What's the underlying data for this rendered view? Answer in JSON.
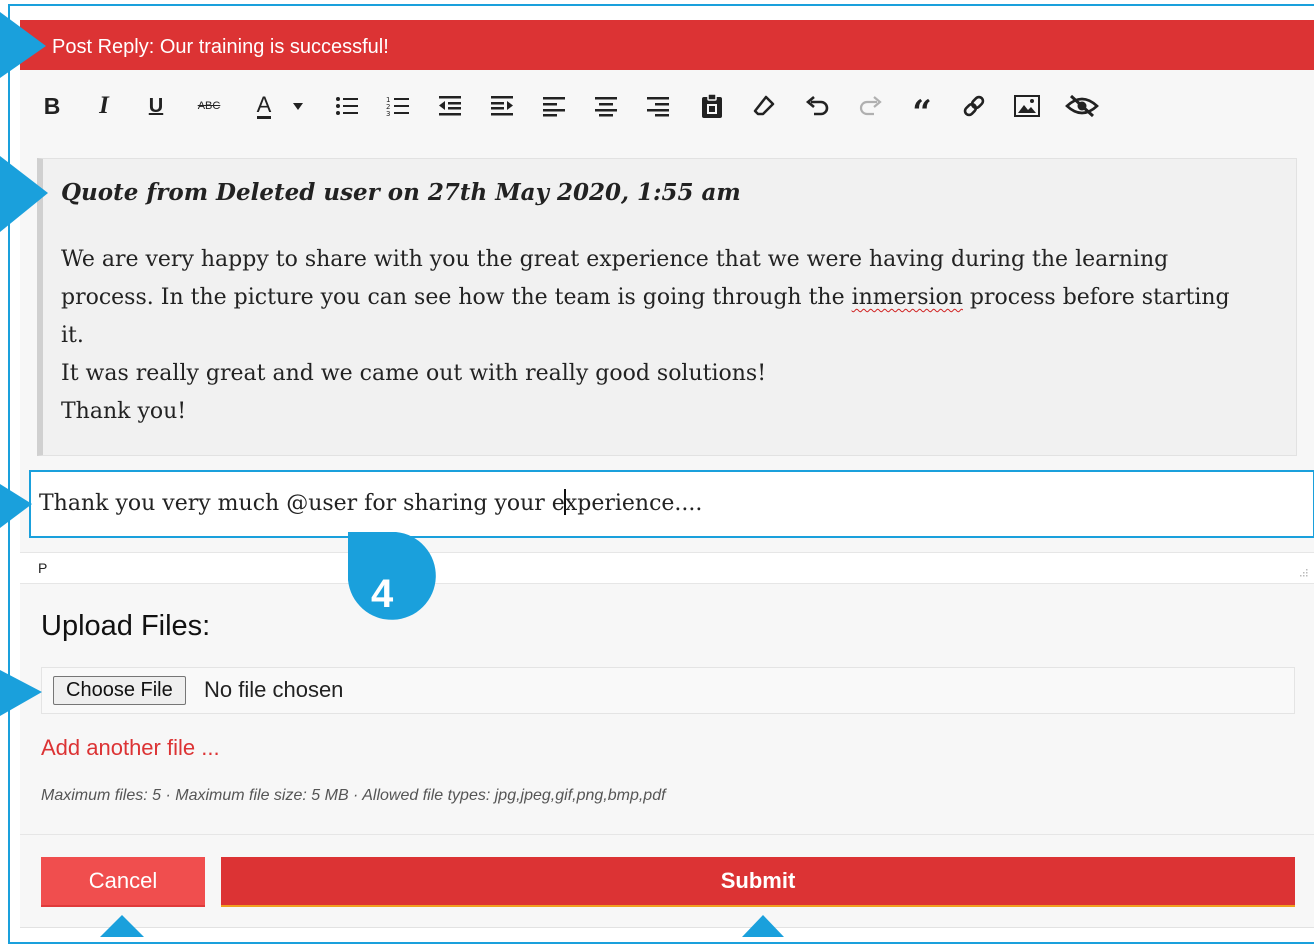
{
  "title": "Post Reply: Our training is successful!",
  "toolbar": {
    "items": [
      {
        "name": "bold-icon"
      },
      {
        "name": "italic-icon"
      },
      {
        "name": "underline-icon"
      },
      {
        "name": "strikethrough-icon"
      },
      {
        "name": "text-color-icon"
      },
      {
        "name": "color-dropdown-icon"
      },
      {
        "name": "bullet-list-icon"
      },
      {
        "name": "numbered-list-icon"
      },
      {
        "name": "outdent-icon"
      },
      {
        "name": "indent-icon"
      },
      {
        "name": "align-left-icon"
      },
      {
        "name": "align-center-icon"
      },
      {
        "name": "align-right-icon"
      },
      {
        "name": "paste-icon"
      },
      {
        "name": "eraser-icon"
      },
      {
        "name": "undo-icon"
      },
      {
        "name": "redo-icon"
      },
      {
        "name": "blockquote-icon"
      },
      {
        "name": "link-icon"
      },
      {
        "name": "image-icon"
      },
      {
        "name": "hide-icon"
      }
    ],
    "strike_label": "ABC",
    "color_label": "A"
  },
  "quote": {
    "header": "Quote from Deleted user on 27th May 2020, 1:55 am",
    "line1": "We are very happy to share with you the great experience that we were having during the learning",
    "line2a": "process.  In the picture you can see how the team is going through the ",
    "line2b": "inmersion",
    "line2c": " process before starting",
    "line3": "it.",
    "line4": "It was really great and we came out with really good solutions!",
    "line5": "Thank you!"
  },
  "reply": {
    "before_caret": "Thank you very much @user for sharing your e",
    "after_caret": "xperience...."
  },
  "statusbar": {
    "path": "P"
  },
  "upload": {
    "title": "Upload Files:",
    "choose_label": "Choose File",
    "no_file": "No file chosen",
    "add_another": "Add another file ...",
    "limits": "Maximum files: 5 · Maximum file size: 5 MB · Allowed file types: jpg,jpeg,gif,png,bmp,pdf"
  },
  "buttons": {
    "cancel": "Cancel",
    "submit": "Submit"
  },
  "annotations": {
    "marker_number": "4"
  },
  "colors": {
    "brand_red": "#dc3334",
    "cancel_red": "#f04e4e",
    "annotation_blue": "#1aa0dc",
    "submit_underline": "#f0a020"
  }
}
